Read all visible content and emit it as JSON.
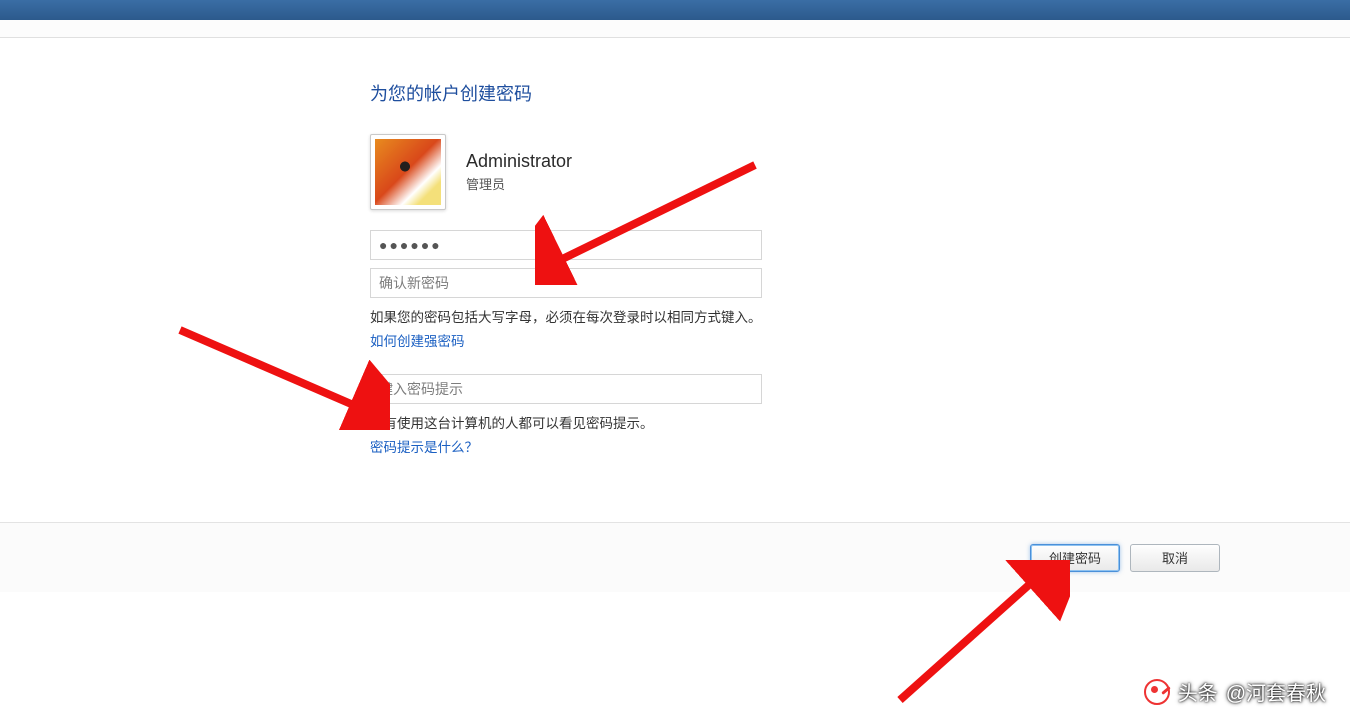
{
  "page": {
    "title": "为您的帐户创建密码"
  },
  "user": {
    "name": "Administrator",
    "role": "管理员"
  },
  "fields": {
    "new_password_value": "●●●●●●",
    "confirm_password_placeholder": "确认新密码",
    "hint_placeholder": "键入密码提示"
  },
  "info": {
    "caps_warning": "如果您的密码包括大写字母，必须在每次登录时以相同方式键入。",
    "strong_password_link": "如何创建强密码",
    "hint_visible_text": "所有使用这台计算机的人都可以看见密码提示。",
    "what_is_hint_link": "密码提示是什么？"
  },
  "buttons": {
    "create": "创建密码",
    "cancel": "取消"
  },
  "watermark": {
    "prefix": "头条",
    "text": "@河套春秋"
  }
}
